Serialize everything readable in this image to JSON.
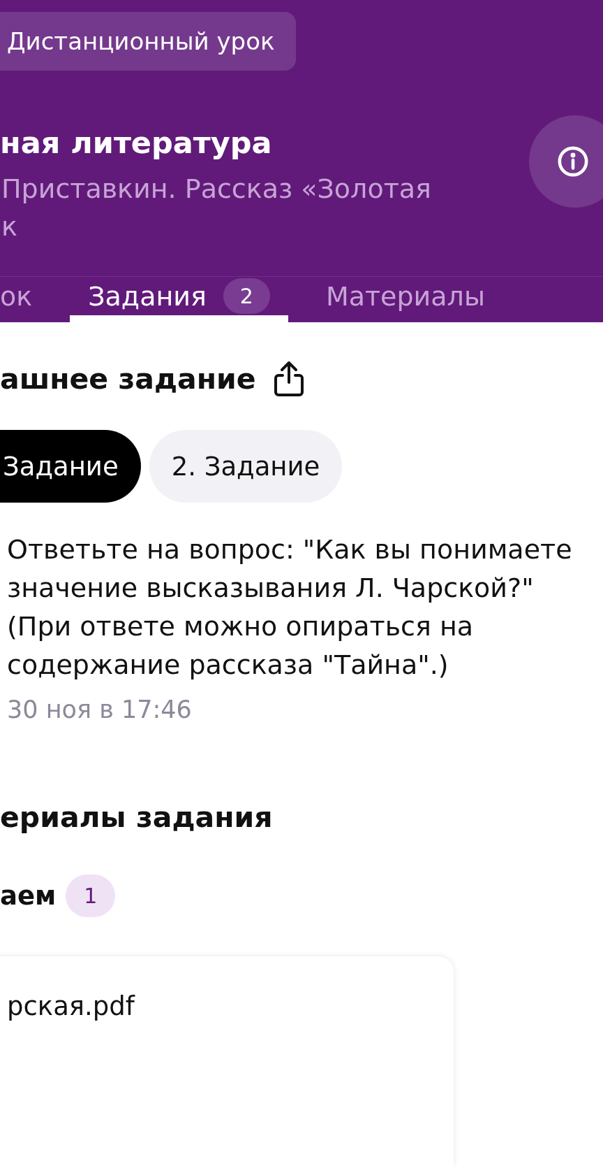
{
  "header": {
    "lesson_type": "Дистанционный урок",
    "title": "ная литература",
    "subtitle": [
      "Приставкин. Рассказ «Золотая",
      "к"
    ]
  },
  "tabs": [
    {
      "label": "ок",
      "selected": false
    },
    {
      "label": "Задания",
      "badge": "2",
      "selected": true
    },
    {
      "label": "Материалы",
      "selected": false
    }
  ],
  "homework": {
    "title": "ашнее задание",
    "task_chips": [
      {
        "label": "Задание",
        "selected": true
      },
      {
        "label": "2. Задание",
        "selected": false
      }
    ],
    "text": "Ответьте на вопрос: \"Как вы понимаете значение высказывания Л. Чарской?\" (При ответе можно опираться на содержание рассказа \"Тайна\".)",
    "date": "30 ноя в 17:46"
  },
  "materials": {
    "title": "ериалы задания",
    "group": {
      "label": "аем",
      "badge": "1"
    },
    "files": [
      {
        "name": "рская.pdf"
      }
    ]
  }
}
